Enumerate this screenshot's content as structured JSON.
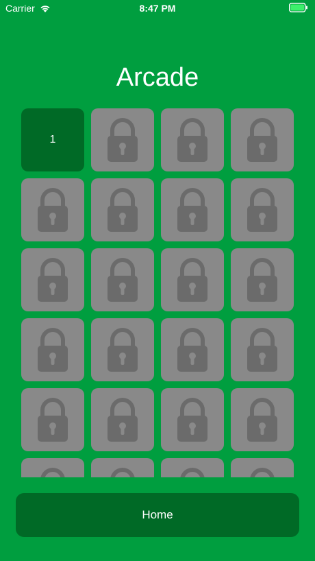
{
  "status_bar": {
    "carrier": "Carrier",
    "time": "8:47 PM"
  },
  "title": "Arcade",
  "levels": [
    {
      "label": "1",
      "locked": false
    },
    {
      "label": "",
      "locked": true
    },
    {
      "label": "",
      "locked": true
    },
    {
      "label": "",
      "locked": true
    },
    {
      "label": "",
      "locked": true
    },
    {
      "label": "",
      "locked": true
    },
    {
      "label": "",
      "locked": true
    },
    {
      "label": "",
      "locked": true
    },
    {
      "label": "",
      "locked": true
    },
    {
      "label": "",
      "locked": true
    },
    {
      "label": "",
      "locked": true
    },
    {
      "label": "",
      "locked": true
    },
    {
      "label": "",
      "locked": true
    },
    {
      "label": "",
      "locked": true
    },
    {
      "label": "",
      "locked": true
    },
    {
      "label": "",
      "locked": true
    },
    {
      "label": "",
      "locked": true
    },
    {
      "label": "",
      "locked": true
    },
    {
      "label": "",
      "locked": true
    },
    {
      "label": "",
      "locked": true
    },
    {
      "label": "",
      "locked": true
    },
    {
      "label": "",
      "locked": true
    },
    {
      "label": "",
      "locked": true
    },
    {
      "label": "",
      "locked": true
    }
  ],
  "home_label": "Home",
  "icons": {
    "locked_tile": "lock-icon",
    "status_wifi": "wifi-icon",
    "status_battery": "battery-icon"
  },
  "colors": {
    "background": "#009e3f",
    "unlocked_tile": "#006a26",
    "locked_tile": "#898989",
    "lock_glyph": "#6b6b6b"
  }
}
